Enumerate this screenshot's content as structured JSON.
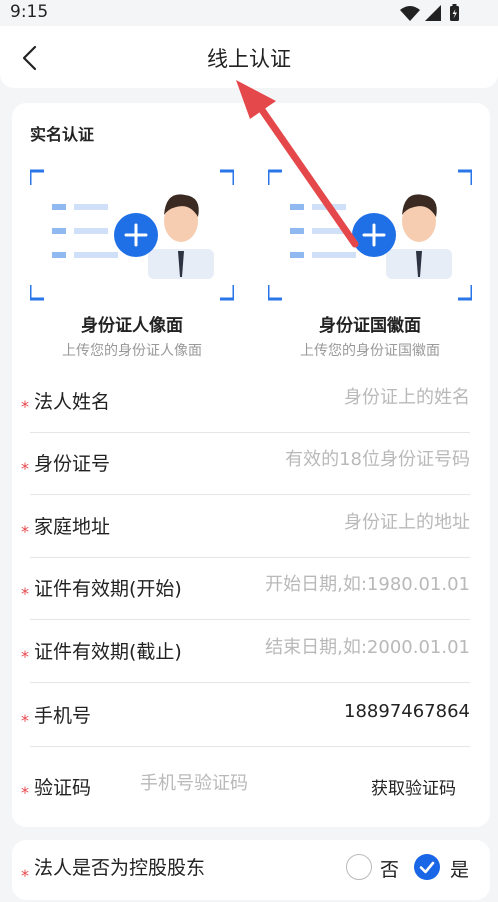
{
  "status_bar": {
    "time": "9:15"
  },
  "header": {
    "title": "线上认证"
  },
  "section": {
    "title": "实名认证"
  },
  "uploads": [
    {
      "title": "身份证人像面",
      "subtitle": "上传您的身份证人像面"
    },
    {
      "title": "身份证国徽面",
      "subtitle": "上传您的身份证国徽面"
    }
  ],
  "form": {
    "required_mark": "*",
    "fields": [
      {
        "label": "法人姓名",
        "placeholder": "身份证上的姓名",
        "value": ""
      },
      {
        "label": "身份证号",
        "placeholder": "有效的18位身份证号码",
        "value": ""
      },
      {
        "label": "家庭地址",
        "placeholder": "身份证上的地址",
        "value": ""
      },
      {
        "label": "证件有效期(开始)",
        "placeholder": "开始日期,如:1980.01.01",
        "value": ""
      },
      {
        "label": "证件有效期(截止)",
        "placeholder": "结束日期,如:2000.01.01",
        "value": ""
      },
      {
        "label": "手机号",
        "placeholder": "",
        "value": "18897467864"
      }
    ],
    "code": {
      "label": "验证码",
      "placeholder": "手机号验证码",
      "button": "获取验证码"
    }
  },
  "controlling": {
    "label": "法人是否为控股股东",
    "options": [
      {
        "label": "否",
        "selected": false
      },
      {
        "label": "是",
        "selected": true
      }
    ]
  },
  "colors": {
    "accent": "#1966e6",
    "required": "#e8474b",
    "annotation": "#e5484b"
  }
}
